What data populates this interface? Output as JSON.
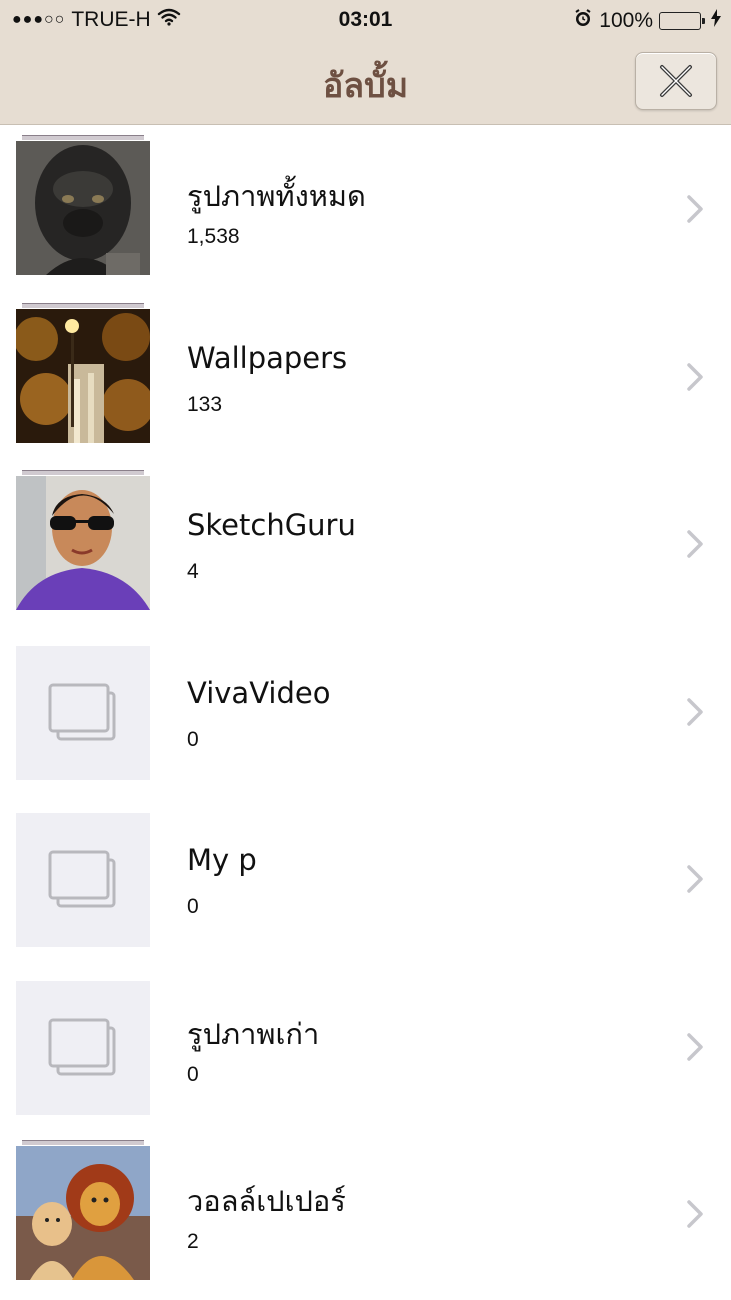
{
  "status": {
    "signal": "●●●○○",
    "carrier": "TRUE-H",
    "time": "03:01",
    "battery": "100%",
    "battery_level": 1.0
  },
  "nav": {
    "title": "อัลบั้ม",
    "close_icon": "close-x-icon"
  },
  "albums": [
    {
      "title": "รูปภาพทั้งหมด",
      "count": "1,538",
      "thumb": "gorilla"
    },
    {
      "title": "Wallpapers",
      "count": "133",
      "thumb": "street-night"
    },
    {
      "title": "SketchGuru",
      "count": "4",
      "thumb": "selfie"
    },
    {
      "title": "VivaVideo",
      "count": "0",
      "thumb": "empty"
    },
    {
      "title": "My p",
      "count": "0",
      "thumb": "empty"
    },
    {
      "title": "รูปภาพเก่า",
      "count": "0",
      "thumb": "empty"
    },
    {
      "title": "วอลล์เปเปอร์",
      "count": "2",
      "thumb": "lion-cartoon"
    }
  ],
  "colors": {
    "nav_background": "#e6ddd2",
    "title_color": "#6e5042",
    "empty_thumb_bg": "#efeff4",
    "chevron": "#c7c7cc",
    "battery_fill": "#4cd964"
  }
}
